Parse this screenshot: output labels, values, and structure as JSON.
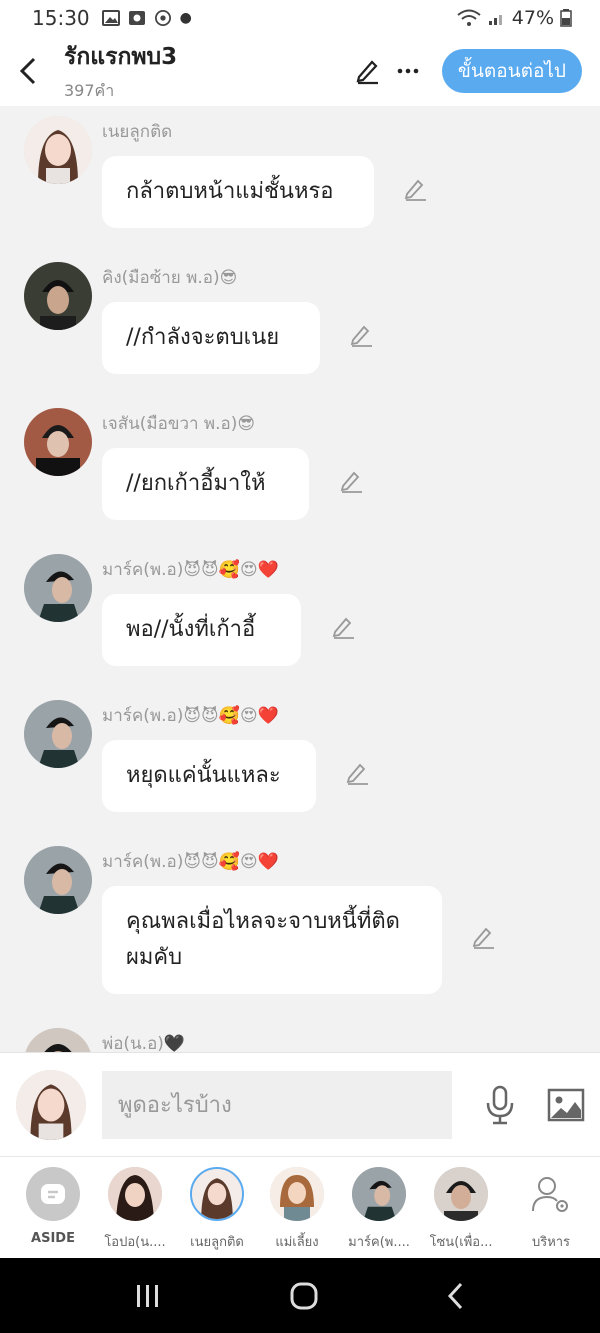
{
  "status_bar": {
    "time": "15:30",
    "battery": "47%"
  },
  "header": {
    "title": "รักแรกพบ3",
    "word_count": "397คำ",
    "next_label": "ขั้นตอนต่อไป"
  },
  "messages": [
    {
      "sender": "เนยลูกติด",
      "text": "กล้าตบหน้าแม่ชั้นหรอ"
    },
    {
      "sender": "คิง(มือซ้าย พ.อ)😎",
      "text": "//กำลังจะตบเนย"
    },
    {
      "sender": "เจสัน(มือขวา พ.อ)😎",
      "text": "//ยกเก้าอี้มาให้"
    },
    {
      "sender": "มาร์ค(พ.อ)😈😈🥰😍❤️",
      "text": "พอ//นั้งที่เก้าอี้"
    },
    {
      "sender": "มาร์ค(พ.อ)😈😈🥰😍❤️",
      "text": "หยุดแค่นั้นแหละ"
    },
    {
      "sender": "มาร์ค(พ.อ)😈😈🥰😍❤️",
      "text": "คุณพลเมื่อไหลจะจาบหนี้ที่ติดผมคับ"
    },
    {
      "sender": "พ่อ(น.อ)🖤",
      "text": ""
    }
  ],
  "input": {
    "placeholder": "พูดอะไรบ้าง"
  },
  "characters": [
    {
      "label": "ASIDE"
    },
    {
      "label": "โอปอ(น...."
    },
    {
      "label": "เนยลูกติด"
    },
    {
      "label": "แม่เลี้ยง"
    },
    {
      "label": "มาร์ค(พ...."
    },
    {
      "label": "โซน(เพื่อ..."
    },
    {
      "label": "บริหาร"
    }
  ],
  "colors": {
    "accent": "#5aaaf0",
    "background": "#f2f2f2",
    "bubble": "#ffffff"
  }
}
